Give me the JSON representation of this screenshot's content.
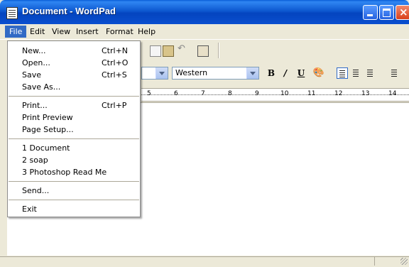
{
  "window": {
    "title": "Document - WordPad"
  },
  "menubar": [
    "File",
    "Edit",
    "View",
    "Insert",
    "Format",
    "Help"
  ],
  "toolbar": {
    "icons": [
      "copy-icon",
      "paste-icon",
      "undo-icon",
      "date-time-icon"
    ]
  },
  "formatbar": {
    "script": "Western",
    "bold": "B",
    "italic": "/",
    "underline": "U"
  },
  "ruler": {
    "marks": [
      "5",
      "6",
      "7",
      "8",
      "9",
      "10",
      "11",
      "12",
      "13",
      "14"
    ]
  },
  "file_menu": {
    "group1": [
      {
        "label": "New...",
        "shortcut": "Ctrl+N"
      },
      {
        "label": "Open...",
        "shortcut": "Ctrl+O"
      },
      {
        "label": "Save",
        "shortcut": "Ctrl+S"
      },
      {
        "label": "Save As...",
        "shortcut": ""
      }
    ],
    "group2": [
      {
        "label": "Print...",
        "shortcut": "Ctrl+P"
      },
      {
        "label": "Print Preview",
        "shortcut": ""
      },
      {
        "label": "Page Setup...",
        "shortcut": ""
      }
    ],
    "recent": [
      {
        "label": "1 Document"
      },
      {
        "label": "2 soap"
      },
      {
        "label": "3 Photoshop Read Me"
      }
    ],
    "send": {
      "label": "Send..."
    },
    "exit": {
      "label": "Exit"
    }
  }
}
